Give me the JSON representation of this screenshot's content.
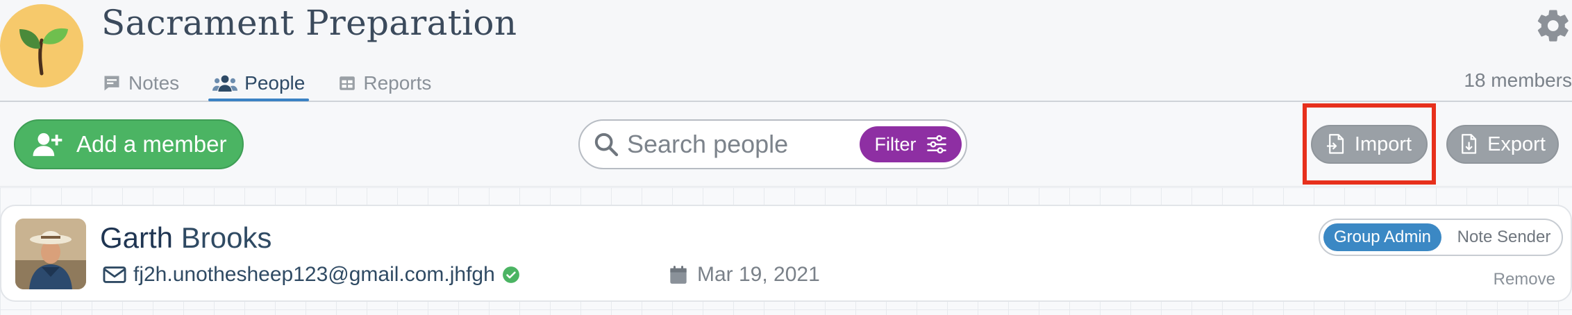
{
  "header": {
    "title": "Sacrament Preparation",
    "members_count": "18 members",
    "tabs": [
      {
        "label": "Notes",
        "icon": "notes-icon",
        "active": false
      },
      {
        "label": "People",
        "icon": "people-icon",
        "active": true
      },
      {
        "label": "Reports",
        "icon": "reports-icon",
        "active": false
      }
    ]
  },
  "toolbar": {
    "add_member_label": "Add a member",
    "search_placeholder": "Search people",
    "filter_label": "Filter",
    "import_label": "Import",
    "export_label": "Export"
  },
  "member": {
    "first_name": "Garth",
    "last_name": "Brooks",
    "email": "fj2h.unothesheep123@gmail.com.jhfgh",
    "email_verified": true,
    "date": "Mar 19, 2021",
    "roles": [
      "Group Admin",
      "Note Sender"
    ],
    "active_role": "Group Admin",
    "remove_label": "Remove"
  },
  "colors": {
    "accent_blue": "#3b88c4",
    "add_green": "#4bb463",
    "filter_purple": "#8e2fa3",
    "neutral_button": "#9aa0a6",
    "highlight_red": "#e7301c"
  }
}
